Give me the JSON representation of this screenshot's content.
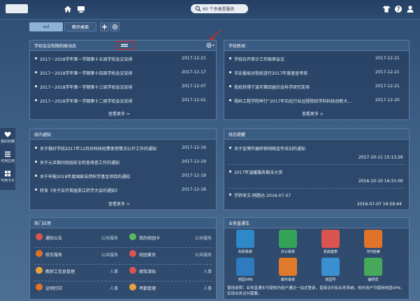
{
  "topbar": {
    "search_label": "60 个多类型服务",
    "home_icon": "home-icon",
    "monitor_icon": "monitor-icon",
    "tshirt_icon": "tshirt-icon",
    "help_icon": "help-icon",
    "user_icon": "user-icon"
  },
  "tabs": [
    {
      "label": "xul"
    },
    {
      "label": "教师桌面"
    }
  ],
  "sidebar": {
    "items": [
      {
        "label": "我的收藏",
        "icon": "heart-icon"
      },
      {
        "label": "可用应用",
        "icon": "list-icon"
      },
      {
        "label": "可用卡片",
        "icon": "cards-icon"
      }
    ]
  },
  "panel_meetings": {
    "title": "学校会议和限制类动态",
    "items": [
      {
        "text": "2017－2018学年第一学期第十五周学校会议安排",
        "date": "2017-12-21"
      },
      {
        "text": "2017－2018学年第一学期第十四周学校会议安排",
        "date": "2017-12-17"
      },
      {
        "text": "2017－2018学年第一学期第十三周学校会议安排",
        "date": "2017-12-07"
      },
      {
        "text": "2017－2018学年第一学期第十二周学校会议安排",
        "date": "2017-12-01"
      }
    ],
    "more": "查看更多 >"
  },
  "panel_news": {
    "title": "学校新闻",
    "items": [
      {
        "text": "学校召开审计工作联席会议",
        "date": "2017-12-21"
      },
      {
        "text": "市安委局对我校进行2017年度普查考核",
        "date": "2017-12-21"
      },
      {
        "text": "我校获得宁波市第四届社会科学研究奖项",
        "date": "2017-12-21"
      },
      {
        "text": "杨码工程学院举行“2017年石化行业远程院校学科科技创新大...",
        "date": "2017-12-20"
      }
    ],
    "more": "查看更多 >"
  },
  "panel_notices": {
    "title": "校内通知",
    "items": [
      {
        "text": "关于做好学校2017年12月份科研经费使用情况公开工作的通知",
        "date": "2017-12-19"
      },
      {
        "text": "关于元旦期间校园安全检查排查工作的通知",
        "date": "2017-12-19"
      },
      {
        "text": "关于申报2018年度国家自然科学基金项目的通知",
        "date": "2017-12-19"
      },
      {
        "text": "转发《关于召开首届浙江药学大会的通知》",
        "date": "2017-12-18"
      }
    ],
    "more": "查看更多 >"
  },
  "panel_todo": {
    "title": "待办提醒",
    "items": [
      {
        "text": "关于宣博开展转移网络宣传培训的通知",
        "date": "2017-10-11 15:13:26"
      },
      {
        "text": "2017年温暖服务期末大资",
        "date": "2016-10-10 16:31:00"
      },
      {
        "text": "学转收文-网题达-2016-07-07",
        "date": "2016-07-07 16:59:44"
      }
    ],
    "more": "查看更多 >"
  },
  "panel_apps": {
    "title": "热门应用",
    "apps": [
      {
        "name": "通知公告",
        "category": "公共服务",
        "icon": "notice-icon",
        "color": "#d9534f"
      },
      {
        "name": "我的校园卡",
        "category": "公共服务",
        "icon": "card-icon",
        "color": "#5cb85c"
      },
      {
        "name": "就车服务",
        "category": "公共服务",
        "icon": "car-icon",
        "color": "#e0732a"
      },
      {
        "name": "校园黄页",
        "category": "公共服务",
        "icon": "book-icon",
        "color": "#d9534f"
      },
      {
        "name": "教职工信息管理",
        "category": "人事",
        "icon": "staff-icon",
        "color": "#e8a23a"
      },
      {
        "name": "绩效津贴",
        "category": "人事",
        "icon": "bonus-icon",
        "color": "#d9534f"
      },
      {
        "name": "证明打印",
        "category": "人事",
        "icon": "print-icon",
        "color": "#e0732a"
      },
      {
        "name": "考勤管理",
        "category": "人事",
        "icon": "clock-icon",
        "color": "#e8a23a"
      }
    ]
  },
  "panel_express": {
    "title": "业务直通车",
    "tiles": [
      {
        "label": "科研系统",
        "icon": "research-icon",
        "color": "#2f88c8"
      },
      {
        "label": "办公系统",
        "icon": "office-icon",
        "color": "#33a35a"
      },
      {
        "label": "机房建表",
        "icon": "server-icon",
        "color": "#d9534f"
      },
      {
        "label": "书刊检索",
        "icon": "library-icon",
        "color": "#e0732a"
      },
      {
        "label": "校园VPN",
        "icon": "vpn-icon",
        "color": "#2f7bbf"
      },
      {
        "label": "邮件系统",
        "icon": "mail-icon",
        "color": "#e07a2a"
      },
      {
        "label": "校园号",
        "icon": "campus-icon",
        "color": "#3a8fd0"
      },
      {
        "label": "辅导员",
        "icon": "counselor-icon",
        "color": "#46a85a"
      }
    ],
    "description": "使用说明：业务直通车可使校内用户通过一站式登录，直接访问有业务系统。校外用户可使用校园VPN，实现业务访问需要。"
  }
}
